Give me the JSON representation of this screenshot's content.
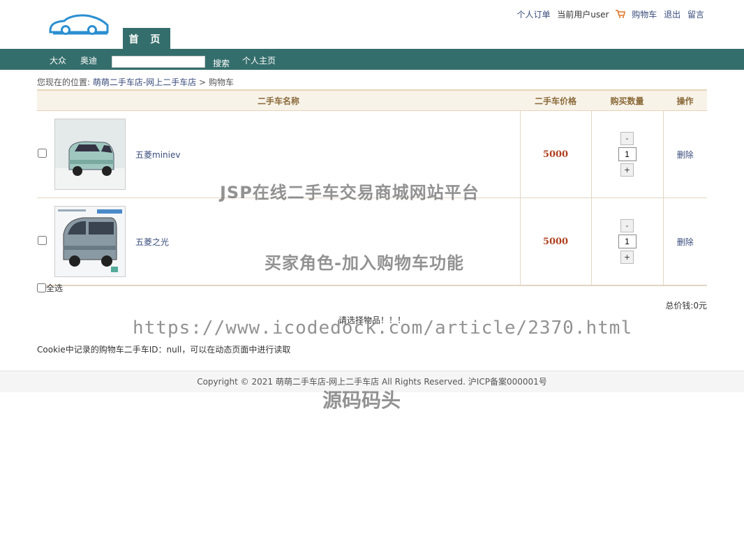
{
  "header": {
    "tab_home": "首 页",
    "links": {
      "orders": "个人订单",
      "current_user": "当前用户user",
      "cart": "购物车",
      "logout": "退出",
      "message": "留言"
    }
  },
  "nav": {
    "items": [
      "大众",
      "奥迪"
    ],
    "search_placeholder": "",
    "search_label": "搜索",
    "home_label": "个人主页"
  },
  "breadcrumb": {
    "prefix": "您现在的位置:",
    "site": "萌萌二手车店-网上二手车店",
    "sep": ">",
    "current": "购物车"
  },
  "cart": {
    "headers": {
      "name": "二手车名称",
      "price": "二手车价格",
      "qty": "购买数量",
      "op": "操作"
    },
    "items": [
      {
        "name": "五菱miniev",
        "price": "5000",
        "qty": "1",
        "delete": "删除",
        "minus": "-",
        "plus": "+"
      },
      {
        "name": "五菱之光",
        "price": "5000",
        "qty": "1",
        "delete": "删除",
        "minus": "-",
        "plus": "+"
      }
    ],
    "select_all": "全选",
    "total": "总价钱:0元",
    "notice": "请选择物品！！！",
    "cookie_info": "Cookie中记录的购物车二手车ID：null，可以在动态页面中进行读取"
  },
  "footer": {
    "text": "Copyright © 2021 萌萌二手车店-网上二手车店 All Rights Reserved. 沪ICP备案000001号"
  },
  "watermarks": {
    "title": "JSP在线二手车交易商城网站平台",
    "subtitle": "买家角色-加入购物车功能",
    "url": "https://www.icodedock.com/article/2370.html",
    "brand": "源码码头"
  },
  "colors": {
    "nav": "#346e6c",
    "price": "#b04020",
    "link": "#3a4d7c"
  }
}
